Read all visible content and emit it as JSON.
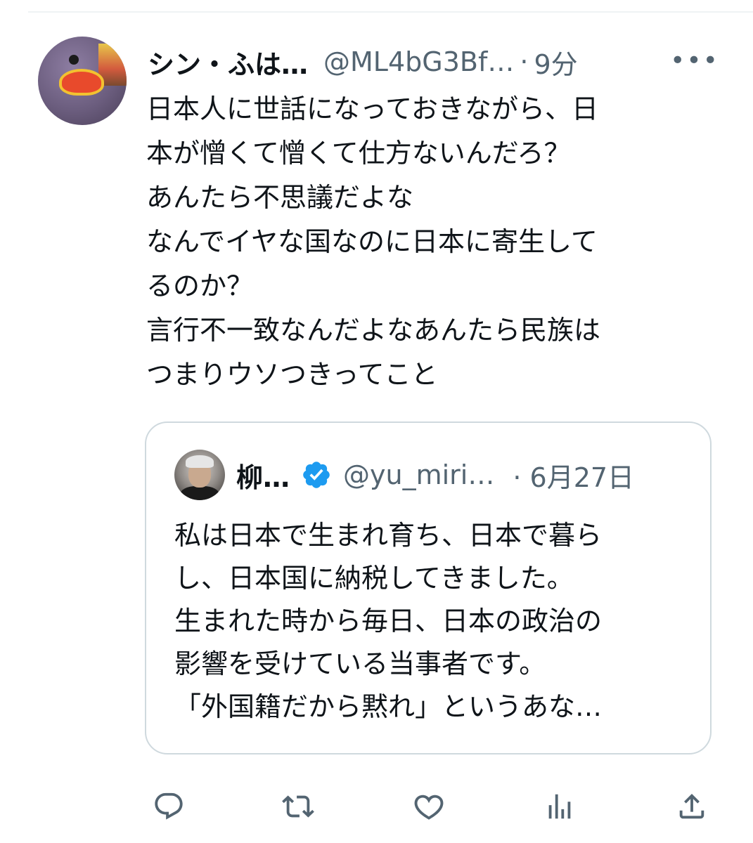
{
  "tweet": {
    "author": {
      "display_name": "シン・ふは…",
      "handle": "@ML4bG3Bf…",
      "separator": "·",
      "time": "9分",
      "avatar_icon": "avatar-photo"
    },
    "more_label": "•••",
    "text": "日本人に世話になっておきながら、日\n本が憎くて憎くて仕方ないんだろ？\nあんたら不思議だよな\nなんでイヤな国なのに日本に寄生して\nるのか？\n言行不一致なんだよなあんたら民族は\nつまりウソつきってこと"
  },
  "quote": {
    "author": {
      "display_name": "柳…",
      "verified": true,
      "handle": "@yu_miri…",
      "separator": "·",
      "time": "6月27日"
    },
    "text": "私は日本で生まれ育ち、日本で暮ら\nし、日本国に納税してきました。\n生まれた時から毎日、日本の政治の\n影響を受けている当事者です。\n「外国籍だから黙れ」というあな…"
  },
  "actions": [
    {
      "name": "reply",
      "icon": "reply-icon"
    },
    {
      "name": "retweet",
      "icon": "retweet-icon"
    },
    {
      "name": "like",
      "icon": "like-icon"
    },
    {
      "name": "views",
      "icon": "analytics-icon"
    },
    {
      "name": "share",
      "icon": "share-icon"
    }
  ],
  "colors": {
    "text": "#0f1419",
    "secondary": "#536471",
    "border": "#cfd9de",
    "verified": "#1d9bf0"
  }
}
